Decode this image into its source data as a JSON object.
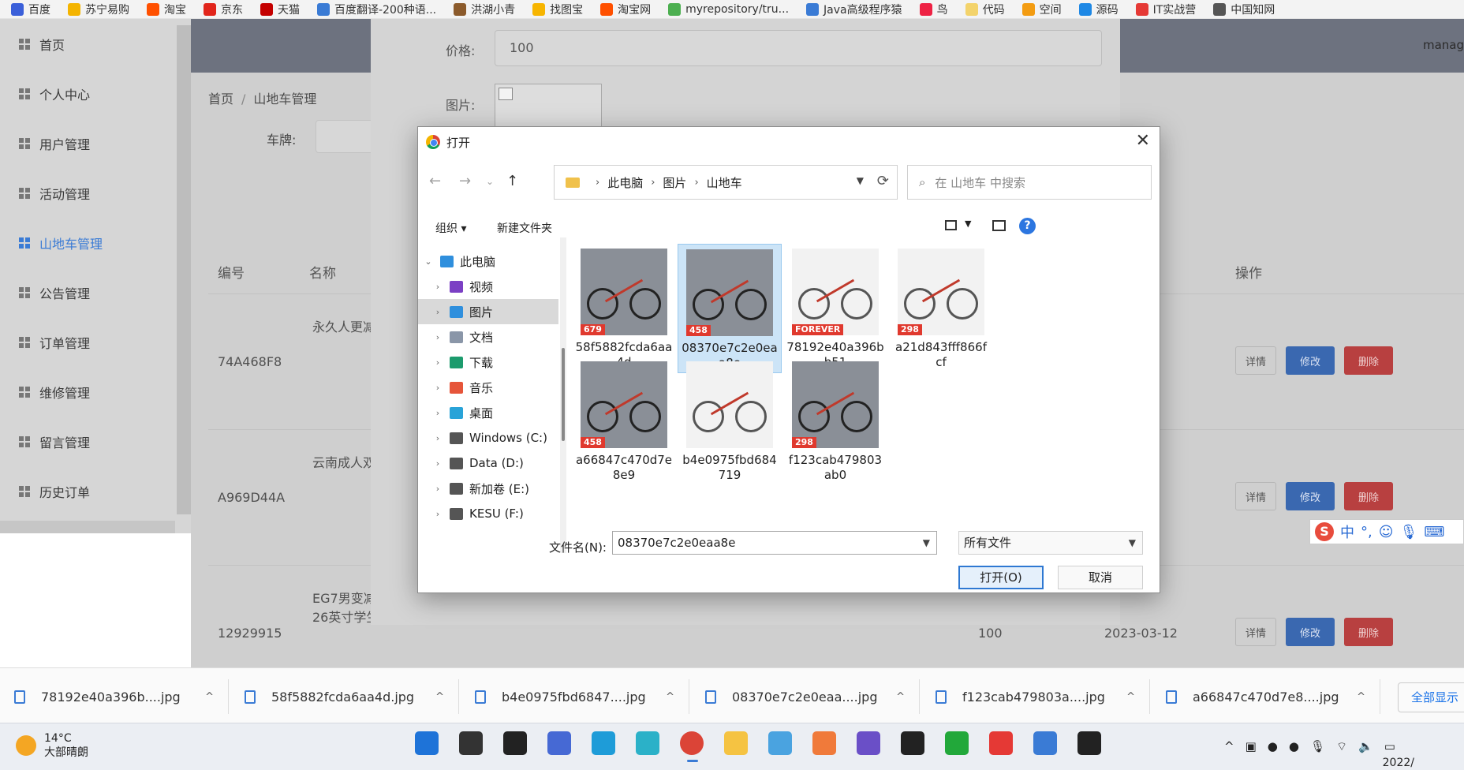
{
  "bookmarks": [
    {
      "label": "百度",
      "color": "#3a5fd9"
    },
    {
      "label": "苏宁易购",
      "color": "#f4b400"
    },
    {
      "label": "淘宝",
      "color": "#ff5000"
    },
    {
      "label": "京东",
      "color": "#e1251b"
    },
    {
      "label": "天猫",
      "color": "#c40000"
    },
    {
      "label": "百度翻译-200种语...",
      "color": "#3a7bd5"
    },
    {
      "label": "洪湖小青",
      "color": "#8b5a2b"
    },
    {
      "label": "找图宝",
      "color": "#f7b500"
    },
    {
      "label": "淘宝网",
      "color": "#ff5000"
    },
    {
      "label": "myrepository/tru...",
      "color": "#4caf50"
    },
    {
      "label": "Java高级程序猿",
      "color": "#3a7bd5"
    },
    {
      "label": "鸟",
      "color": "#e24"
    },
    {
      "label": "代码",
      "color": "#f3d36b"
    },
    {
      "label": "空间",
      "color": "#f39c12"
    },
    {
      "label": "源码",
      "color": "#1e88e5"
    },
    {
      "label": "IT实战营",
      "color": "#e53935"
    },
    {
      "label": "中国知网",
      "color": "#555"
    }
  ],
  "sidebar": {
    "items": [
      {
        "label": "首页",
        "active": false
      },
      {
        "label": "个人中心",
        "active": false
      },
      {
        "label": "用户管理",
        "active": false
      },
      {
        "label": "活动管理",
        "active": false
      },
      {
        "label": "山地车管理",
        "active": true
      },
      {
        "label": "公告管理",
        "active": false
      },
      {
        "label": "订单管理",
        "active": false
      },
      {
        "label": "维修管理",
        "active": false
      },
      {
        "label": "留言管理",
        "active": false
      },
      {
        "label": "历史订单",
        "active": false
      }
    ]
  },
  "header": {
    "user": "manag"
  },
  "breadcrumb": {
    "home": "首页",
    "sep": "/",
    "current": "山地车管理"
  },
  "filter": {
    "plate_label": "车牌:"
  },
  "table": {
    "headers": {
      "id": "编号",
      "name": "名称",
      "ops": "操作"
    },
    "rows": [
      {
        "id": "74A468F8",
        "name": "永久人更减震单车",
        "date": "",
        "extra": ""
      },
      {
        "id": "A969D44A",
        "name": "云南成人双减少年",
        "date": "",
        "extra": ""
      },
      {
        "id": "12929915",
        "name": "EG7男变减震赛车26英寸学生青",
        "date": "2023-03-12",
        "extra": "100"
      }
    ],
    "actions": {
      "detail": "详情",
      "edit": "修改",
      "delete": "删除"
    }
  },
  "edit_modal": {
    "price_label": "价格:",
    "price_value": "100",
    "image_label": "图片:"
  },
  "dialog": {
    "title": "打开",
    "path": [
      "此电脑",
      "图片",
      "山地车"
    ],
    "search_placeholder": "在 山地车 中搜索",
    "organize": "组织 ▾",
    "new_folder": "新建文件夹",
    "help": "?",
    "tree": [
      {
        "label": "此电脑",
        "icon_color": "#2f8fdd",
        "expanded": true,
        "indent": 0,
        "selected": false
      },
      {
        "label": "视频",
        "icon_color": "#7b3fc4",
        "expanded": false,
        "indent": 1,
        "selected": false
      },
      {
        "label": "图片",
        "icon_color": "#2f8fdd",
        "expanded": false,
        "indent": 1,
        "selected": true
      },
      {
        "label": "文档",
        "icon_color": "#8a96a8",
        "expanded": false,
        "indent": 1,
        "selected": false
      },
      {
        "label": "下载",
        "icon_color": "#1c9b6d",
        "expanded": false,
        "indent": 1,
        "selected": false
      },
      {
        "label": "音乐",
        "icon_color": "#e6553a",
        "expanded": false,
        "indent": 1,
        "selected": false
      },
      {
        "label": "桌面",
        "icon_color": "#29a3d8",
        "expanded": false,
        "indent": 1,
        "selected": false
      },
      {
        "label": "Windows (C:)",
        "icon_color": "#555",
        "expanded": false,
        "indent": 1,
        "selected": false
      },
      {
        "label": "Data (D:)",
        "icon_color": "#555",
        "expanded": false,
        "indent": 1,
        "selected": false
      },
      {
        "label": "新加卷 (E:)",
        "icon_color": "#555",
        "expanded": false,
        "indent": 1,
        "selected": false
      },
      {
        "label": "KESU (F:)",
        "icon_color": "#555",
        "expanded": false,
        "indent": 1,
        "selected": false
      }
    ],
    "files": [
      {
        "name": "58f5882fcda6aa4d",
        "tag": "679",
        "selected": false,
        "light": false
      },
      {
        "name": "08370e7c2e0eaa8e",
        "tag": "458",
        "selected": true,
        "light": false
      },
      {
        "name": "78192e40a396bb51",
        "tag": "FOREVER",
        "selected": false,
        "light": true
      },
      {
        "name": "a21d843fff866fcf",
        "tag": "298",
        "selected": false,
        "light": true
      },
      {
        "name": "a66847c470d7e8e9",
        "tag": "458",
        "selected": false,
        "light": false
      },
      {
        "name": "b4e0975fbd684719",
        "tag": "",
        "selected": false,
        "light": true
      },
      {
        "name": "f123cab479803ab0",
        "tag": "298",
        "selected": false,
        "light": false
      }
    ],
    "filename_label": "文件名(N):",
    "filename_value": "08370e7c2e0eaa8e",
    "filetype": "所有文件",
    "open_button": "打开(O)",
    "cancel_button": "取消"
  },
  "downloads": [
    "78192e40a396b....jpg",
    "58f5882fcda6aa4d.jpg",
    "b4e0975fbd6847....jpg",
    "08370e7c2e0eaa....jpg",
    "f123cab479803a....jpg",
    "a66847c470d7e8....jpg"
  ],
  "downloads_show_all": "全部显示",
  "ime": {
    "logo": "S",
    "lang": "中",
    "punct": "°,"
  },
  "taskbar": {
    "weather_temp": "14°C",
    "weather_desc": "大部晴朗",
    "apps": [
      {
        "name": "start-icon",
        "color": "#1e73d8"
      },
      {
        "name": "search-icon",
        "color": "#333"
      },
      {
        "name": "task-view-icon",
        "color": "#222"
      },
      {
        "name": "app-icon-1",
        "color": "#4669d4"
      },
      {
        "name": "edge-icon",
        "color": "#1e9cd8"
      },
      {
        "name": "edge-dev-icon",
        "color": "#2bb1c8"
      },
      {
        "name": "chrome-icon",
        "color": "#db4437"
      },
      {
        "name": "explorer-icon",
        "color": "#f5c342"
      },
      {
        "name": "app-icon-2",
        "color": "#4aa3e0"
      },
      {
        "name": "app-icon-3",
        "color": "#f07a3a"
      },
      {
        "name": "app-icon-4",
        "color": "#6a4fc7"
      },
      {
        "name": "intellij-icon",
        "color": "#222"
      },
      {
        "name": "hbuilder-icon",
        "color": "#22a83a"
      },
      {
        "name": "wps-icon",
        "color": "#e53935"
      },
      {
        "name": "notepad-icon",
        "color": "#3a7bd5"
      },
      {
        "name": "terminal-icon",
        "color": "#222"
      }
    ],
    "clock": "2022/"
  }
}
